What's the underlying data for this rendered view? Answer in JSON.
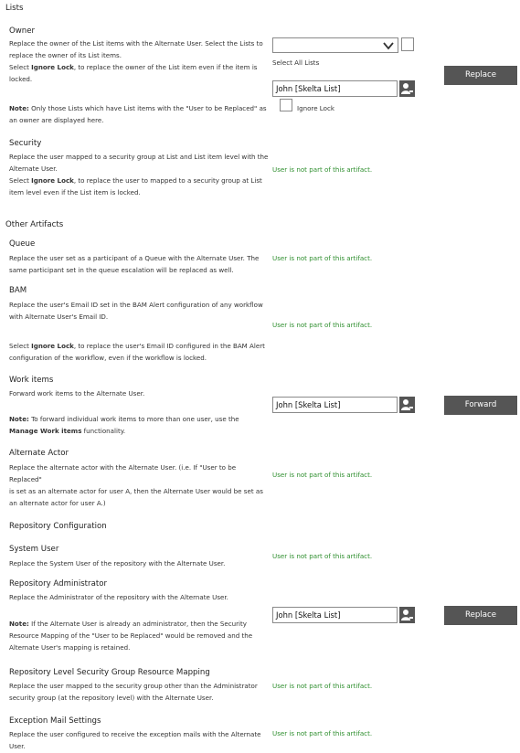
{
  "lists": {
    "heading": "Lists",
    "owner": {
      "title": "Owner",
      "line1": "Replace the owner of the List items with the Alternate User. Select the Lists to",
      "line2": "replace the owner of its List items.",
      "line3_pre": "Select ",
      "line3_bold": "Ignore Lock",
      "line3_post": ", to replace the owner of the List item even if the item is",
      "line4": "locked.",
      "note_bold": "Note:",
      "note_line1": " Only those Lists which have List items with the \"User to be Replaced\" as",
      "note_line2": "an owner are displayed here.",
      "select_all_label": "Select All Lists",
      "user_value": "John [Skelta List]",
      "ignore_lock_label": "Ignore Lock",
      "button_label": "Replace"
    },
    "security": {
      "title": "Security",
      "line1": "Replace the user mapped to a security group at List and List item level with the",
      "line2": "Alternate User.",
      "line3_pre": "Select ",
      "line3_bold": "Ignore Lock",
      "line3_post": ", to replace the user to mapped to a security group at List",
      "line4": "item level even if the List item is locked.",
      "status": "User is not part of this artifact."
    }
  },
  "other": {
    "heading": "Other Artifacts",
    "queue": {
      "title": "Queue",
      "line1": "Replace the user set as a participant of a Queue with the Alternate User. The",
      "line2": "same participant set in the queue escalation will be replaced as well.",
      "status": "User is not part of this artifact."
    },
    "bam": {
      "title": "BAM",
      "line1": "Replace the user's Email ID set in the BAM Alert configuration of any workflow",
      "line2": "with Alternate User's Email ID.",
      "line3_pre": "Select ",
      "line3_bold": "Ignore Lock",
      "line3_post": ", to replace the user's Email ID configured in the BAM Alert",
      "line4": "configuration of the workflow, even if the workflow is locked.",
      "status": "User is not part of this artifact."
    },
    "workitems": {
      "title": "Work items",
      "line1": "Forward work items to the Alternate User.",
      "note_bold": "Note:",
      "note_line1": " To forward individual work items to more than one user, use the",
      "note_line2_bold": "Manage Work items",
      "note_line2_post": " functionality.",
      "user_value": "John [Skelta List]",
      "button_label": "Forward"
    },
    "alternate_actor": {
      "title": "Alternate Actor",
      "line1": "Replace the alternate actor with the Alternate User. (i.e. If \"User to be Replaced\"",
      "line2": "is set as an alternate actor for user A, then the Alternate User would be set as",
      "line3": "an alternate actor for user A.)",
      "status": "User is not part of this artifact."
    }
  },
  "repo": {
    "heading": "Repository Configuration",
    "system_user": {
      "title": "System User",
      "line1": "Replace the System User of the repository with the Alternate User.",
      "status": "User is not part of this artifact."
    },
    "admin": {
      "title": "Repository Administrator",
      "line1": "Replace the Administrator of the repository with the Alternate User.",
      "note_bold": "Note:",
      "note_line1": " If the Alternate User is already an administrator, then the Security",
      "note_line2": "Resource Mapping of the \"User to be Replaced\" would be removed and the",
      "note_line3": "Alternate User's mapping is retained.",
      "user_value": "John [Skelta List]",
      "button_label": "Replace"
    },
    "rlsg": {
      "title": "Repository Level Security Group Resource Mapping",
      "line1": "Replace the user mapped to the security group other than the Administrator",
      "line2": "security group (at the repository level) with the Alternate User.",
      "status": "User is not part of this artifact."
    },
    "exception": {
      "title": "Exception Mail Settings",
      "line1": "Replace the user configured to receive the exception mails with the Alternate",
      "line2": "User.",
      "status": "User is not part of this artifact."
    }
  },
  "icons": {
    "user_picker": "user-icon",
    "dropdown": "chevron-down-icon"
  },
  "colors": {
    "status_green": "#2f8f2f",
    "button_bg": "#555555"
  }
}
